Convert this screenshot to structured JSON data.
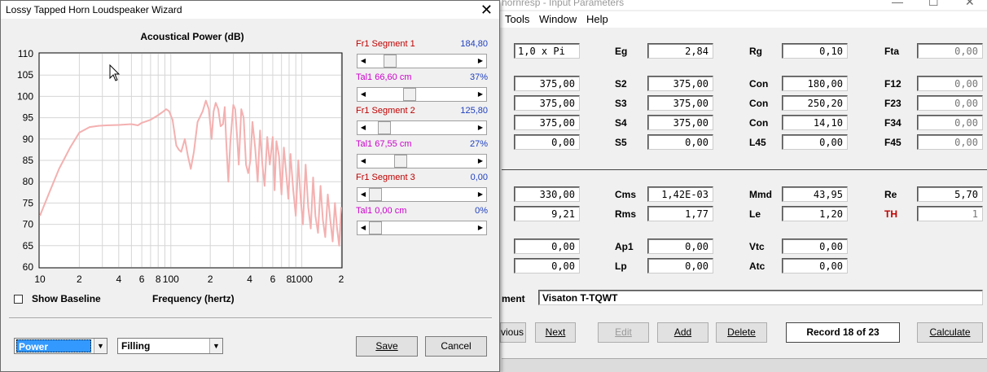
{
  "main": {
    "title": "hornresp - Input Parameters",
    "menu": [
      "Tools",
      "Window",
      "Help"
    ],
    "rows_top": [
      {
        "c1": "1,0 x Pi",
        "l2": "Eg",
        "v2": "2,84",
        "l3": "Rg",
        "v3": "0,10",
        "l4": "Fta",
        "v4": "0,00"
      },
      {
        "c1": "375,00",
        "l2": "S2",
        "v2": "375,00",
        "l3": "Con",
        "v3": "180,00",
        "l4": "F12",
        "v4": "0,00"
      },
      {
        "c1": "375,00",
        "l2": "S3",
        "v2": "375,00",
        "l3": "Con",
        "v3": "250,20",
        "l4": "F23",
        "v4": "0,00"
      },
      {
        "c1": "375,00",
        "l2": "S4",
        "v2": "375,00",
        "l3": "Con",
        "v3": "14,10",
        "l4": "F34",
        "v4": "0,00"
      },
      {
        "c1": "0,00",
        "l2": "S5",
        "v2": "0,00",
        "l3": "L45",
        "v3": "0,00",
        "l4": "F45",
        "v4": "0,00"
      }
    ],
    "rows_bottom": [
      {
        "c1": "330,00",
        "l2": "Cms",
        "v2": "1,42E-03",
        "l3": "Mmd",
        "v3": "43,95",
        "l4": "Re",
        "v4": "5,70"
      },
      {
        "c1": "9,21",
        "l2": "Rms",
        "v2": "1,77",
        "l3": "Le",
        "v3": "1,20",
        "l4": "TH",
        "v4": "1"
      },
      {
        "c1": "0,00",
        "l2": "Ap1",
        "v2": "0,00",
        "l3": "Vtc",
        "v3": "0,00"
      },
      {
        "c1": "0,00",
        "l2": "Lp",
        "v2": "0,00",
        "l3": "Atc",
        "v3": "0,00"
      }
    ],
    "comment_label": "ment",
    "comment_value": "Visaton T-TQWT",
    "buttons": {
      "previous": "vious",
      "next": "Next",
      "edit": "Edit",
      "add": "Add",
      "delete": "Delete",
      "record": "Record 18 of 23",
      "calculate": "Calculate"
    }
  },
  "dialog": {
    "title": "Lossy Tapped Horn Loudspeaker Wizard",
    "close_icon": "close-icon",
    "show_baseline": "Show Baseline",
    "show_baseline_checked": false,
    "frequency_label": "Frequency (hertz)",
    "combo_power": "Power",
    "combo_filling": "Filling",
    "save": "Save",
    "cancel": "Cancel",
    "segments": [
      {
        "label": "Fr1  Segment 1",
        "value": "184,80",
        "slider": 0.16,
        "color": "#c00000"
      },
      {
        "label": "Tal1  66,60 cm",
        "value": "37%",
        "slider": 0.37,
        "color": "#cc00cc"
      },
      {
        "label": "Fr1  Segment 2",
        "value": "125,80",
        "slider": 0.1,
        "color": "#c00000"
      },
      {
        "label": "Tal1  67,55 cm",
        "value": "27%",
        "slider": 0.27,
        "color": "#cc00cc"
      },
      {
        "label": "Fr1  Segment 3",
        "value": "0,00",
        "slider": 0.0,
        "color": "#c00000"
      },
      {
        "label": "Tal1  0,00 cm",
        "value": "0%",
        "slider": 0.0,
        "color": "#cc00cc"
      }
    ]
  },
  "chart_data": {
    "type": "line",
    "title": "Acoustical Power (dB)",
    "xlabel": "Frequency (hertz)",
    "ylabel": "",
    "x_scale": "log",
    "xlim": [
      10,
      2000
    ],
    "ylim": [
      60,
      110
    ],
    "x_tick_labels": [
      "10",
      "2",
      "4",
      "6",
      "8",
      "100",
      "2",
      "4",
      "6",
      "8",
      "1000",
      "2"
    ],
    "y_tick_labels": [
      "110",
      "105",
      "100",
      "95",
      "90",
      "85",
      "80",
      "75",
      "70",
      "65",
      "60"
    ],
    "grid": true,
    "line_color": "#f4b0b0",
    "series": [
      {
        "x": [
          10,
          12,
          14,
          17,
          20,
          24,
          28,
          32,
          40,
          50,
          56,
          60,
          70,
          80,
          88,
          92,
          97,
          103,
          110,
          115,
          120,
          128,
          135,
          142,
          150,
          160,
          175,
          185,
          195,
          200,
          205,
          212,
          220,
          230,
          240,
          250,
          258,
          265,
          275,
          285,
          300,
          310,
          320,
          330,
          345,
          360,
          375,
          390,
          405,
          420,
          440,
          460,
          480,
          500,
          520,
          545,
          570,
          600,
          620,
          640,
          670,
          700,
          730,
          760,
          790,
          820,
          860,
          900,
          940,
          980,
          1020,
          1070,
          1120,
          1170,
          1220,
          1270,
          1330,
          1390,
          1450,
          1510,
          1580,
          1650,
          1720,
          1790,
          1860,
          1930,
          2000
        ],
        "y": [
          72,
          78,
          83,
          88,
          91.5,
          92.8,
          93.1,
          93.2,
          93.3,
          93.5,
          93.2,
          93.8,
          94.5,
          95.6,
          96.5,
          97,
          96.5,
          94.5,
          88.5,
          87.5,
          87,
          90,
          86,
          83,
          87,
          94,
          96.5,
          99,
          97,
          93.5,
          90,
          96.5,
          98.5,
          97,
          93,
          93.5,
          97.5,
          89,
          80,
          89.5,
          98,
          97,
          91,
          84,
          97,
          95,
          84,
          82,
          85,
          94,
          88,
          80,
          92,
          84,
          79,
          90.5,
          84,
          90.5,
          78,
          89.5,
          86,
          77,
          88,
          82,
          76,
          86.5,
          78,
          72,
          85,
          76,
          70,
          84,
          74,
          69,
          81,
          72,
          68,
          79,
          71,
          67,
          77,
          71,
          66,
          75,
          69,
          65,
          74
        ]
      }
    ]
  }
}
